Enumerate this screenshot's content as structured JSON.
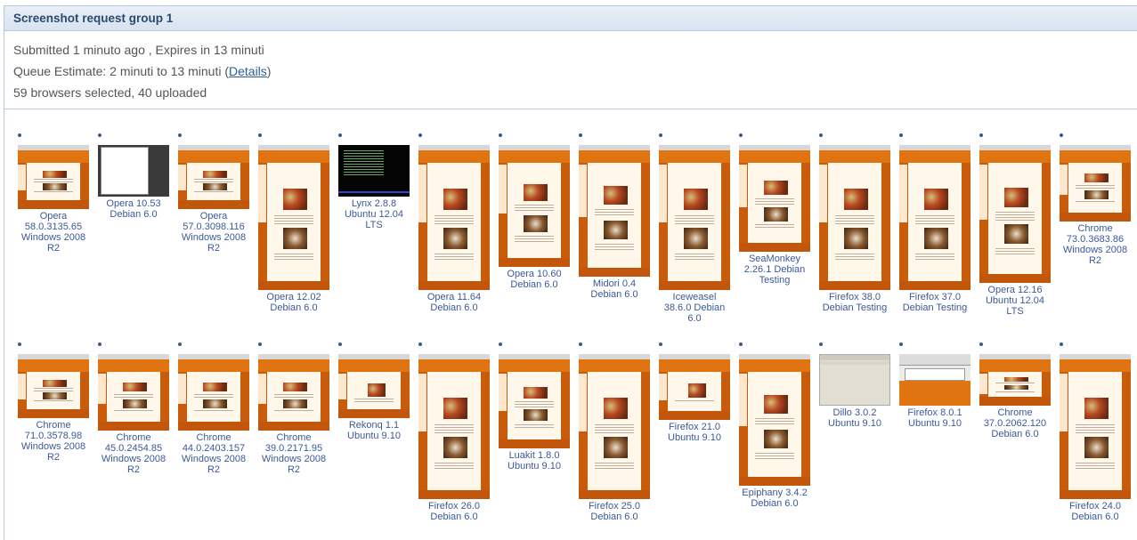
{
  "header": {
    "title": "Screenshot request group 1"
  },
  "info": {
    "submitted": "Submitted 1 minuto ago , Expires in 13 minuti",
    "queue_prefix": "Queue Estimate: 2 minuti to 13 minuti (",
    "details_link": "Details",
    "queue_suffix": ")",
    "browsers": "59 browsers selected, 40 uploaded"
  },
  "row1": [
    {
      "l1": "Opera",
      "l2": "58.0.3135.65",
      "l3": "Windows 2008",
      "l4": "R2",
      "thumb": "web"
    },
    {
      "l1": "Opera 10.53",
      "l2": "Debian 6.0",
      "l3": "",
      "l4": "",
      "thumb": "blank"
    },
    {
      "l1": "Opera",
      "l2": "57.0.3098.116",
      "l3": "Windows 2008",
      "l4": "R2",
      "thumb": "web"
    },
    {
      "l1": "Opera 12.02",
      "l2": "Debian 6.0",
      "l3": "",
      "l4": "",
      "thumb": "web"
    },
    {
      "l1": "Lynx 2.8.8",
      "l2": "Ubuntu 12.04",
      "l3": "LTS",
      "l4": "",
      "thumb": "term"
    },
    {
      "l1": "Opera 11.64",
      "l2": "Debian 6.0",
      "l3": "",
      "l4": "",
      "thumb": "web"
    },
    {
      "l1": "Opera 10.60",
      "l2": "Debian 6.0",
      "l3": "",
      "l4": "",
      "thumb": "web"
    },
    {
      "l1": "Midori 0.4",
      "l2": "Debian 6.0",
      "l3": "",
      "l4": "",
      "thumb": "web"
    },
    {
      "l1": "Iceweasel",
      "l2": "38.6.0 Debian",
      "l3": "6.0",
      "l4": "",
      "thumb": "web"
    },
    {
      "l1": "SeaMonkey",
      "l2": "2.26.1 Debian",
      "l3": "Testing",
      "l4": "",
      "thumb": "web"
    },
    {
      "l1": "Firefox 38.0",
      "l2": "Debian Testing",
      "l3": "",
      "l4": "",
      "thumb": "web"
    },
    {
      "l1": "Firefox 37.0",
      "l2": "Debian Testing",
      "l3": "",
      "l4": "",
      "thumb": "web"
    },
    {
      "l1": "Opera 12.16",
      "l2": "Ubuntu 12.04",
      "l3": "LTS",
      "l4": "",
      "thumb": "web"
    },
    {
      "l1": "Chrome",
      "l2": "73.0.3683.86",
      "l3": "Windows 2008",
      "l4": "R2",
      "thumb": "web"
    }
  ],
  "row2": [
    {
      "l1": "Chrome",
      "l2": "71.0.3578.98",
      "l3": "Windows 2008",
      "l4": "R2",
      "thumb": "web"
    },
    {
      "l1": "Chrome",
      "l2": "45.0.2454.85",
      "l3": "Windows 2008",
      "l4": "R2",
      "thumb": "web"
    },
    {
      "l1": "Chrome",
      "l2": "44.0.2403.157",
      "l3": "Windows 2008",
      "l4": "R2",
      "thumb": "web"
    },
    {
      "l1": "Chrome",
      "l2": "39.0.2171.95",
      "l3": "Windows 2008",
      "l4": "R2",
      "thumb": "web"
    },
    {
      "l1": "Rekonq 1.1",
      "l2": "Ubuntu 9.10",
      "l3": "",
      "l4": "",
      "thumb": "web"
    },
    {
      "l1": "Firefox 26.0",
      "l2": "Debian 6.0",
      "l3": "",
      "l4": "",
      "thumb": "web"
    },
    {
      "l1": "Luakit 1.8.0",
      "l2": "Ubuntu 9.10",
      "l3": "",
      "l4": "",
      "thumb": "web"
    },
    {
      "l1": "Firefox 25.0",
      "l2": "Debian 6.0",
      "l3": "",
      "l4": "",
      "thumb": "web"
    },
    {
      "l1": "Firefox 21.0",
      "l2": "Ubuntu 9.10",
      "l3": "",
      "l4": "",
      "thumb": "web"
    },
    {
      "l1": "Epiphany 3.4.2",
      "l2": "Debian 6.0",
      "l3": "",
      "l4": "",
      "thumb": "web"
    },
    {
      "l1": "Dillo 3.0.2",
      "l2": "Ubuntu 9.10",
      "l3": "",
      "l4": "",
      "thumb": "grey"
    },
    {
      "l1": "Firefox 8.0.1",
      "l2": "Ubuntu 9.10",
      "l3": "",
      "l4": "",
      "thumb": "dialog"
    },
    {
      "l1": "Chrome",
      "l2": "37.0.2062.120",
      "l3": "Debian 6.0",
      "l4": "",
      "thumb": "web"
    },
    {
      "l1": "Firefox 24.0",
      "l2": "Debian 6.0",
      "l3": "",
      "l4": "",
      "thumb": "web"
    }
  ]
}
